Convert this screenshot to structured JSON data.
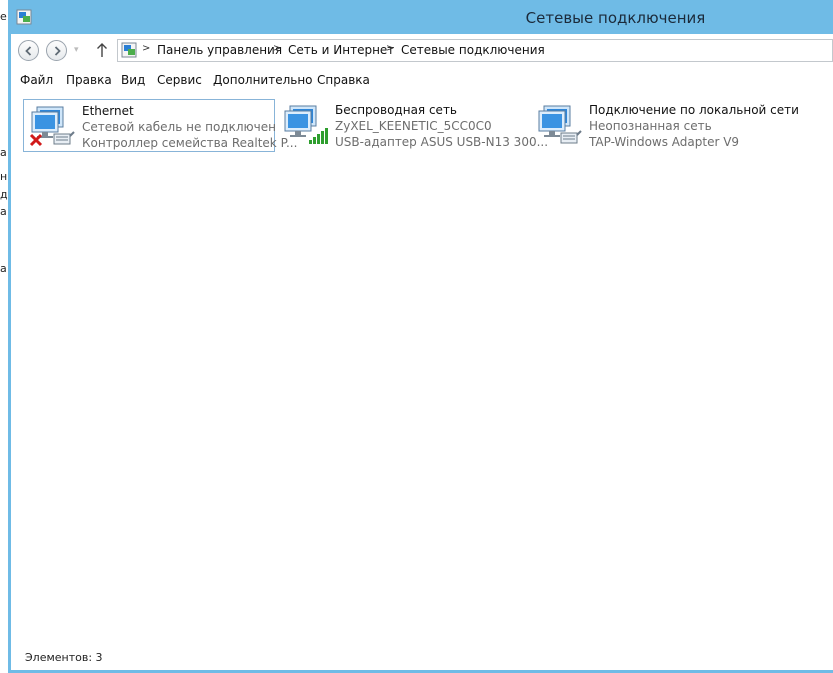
{
  "window": {
    "title": "Сетевые подключения"
  },
  "left_strip": [
    "е",
    "а",
    "н",
    "д",
    "а",
    "а"
  ],
  "breadcrumb": [
    "Панель управления",
    "Сеть и Интернет",
    "Сетевые подключения"
  ],
  "menu": [
    "Файл",
    "Правка",
    "Вид",
    "Сервис",
    "Дополнительно",
    "Справка"
  ],
  "connections": [
    {
      "name": "Ethernet",
      "status": "Сетевой кабель не подключен",
      "device": "Контроллер семейства Realtek P...",
      "overlay": "disconnected-x-icon"
    },
    {
      "name": "Беспроводная сеть",
      "status": "ZyXEL_KEENETIC_5CC0C0",
      "device": "USB-адаптер ASUS USB-N13 300...",
      "overlay": "signal-bars-icon"
    },
    {
      "name": "Подключение по локальной сети",
      "status": "Неопознанная сеть",
      "device": "TAP-Windows Adapter V9",
      "overlay": "network-cable-icon"
    }
  ],
  "status_bar": {
    "items_text": "Элементов: 3"
  },
  "colors": {
    "titlebar": "#6fbbe6",
    "selection_border": "#88b4d8",
    "disconnected": "#d11a1a",
    "signal": "#2e9e2e"
  }
}
